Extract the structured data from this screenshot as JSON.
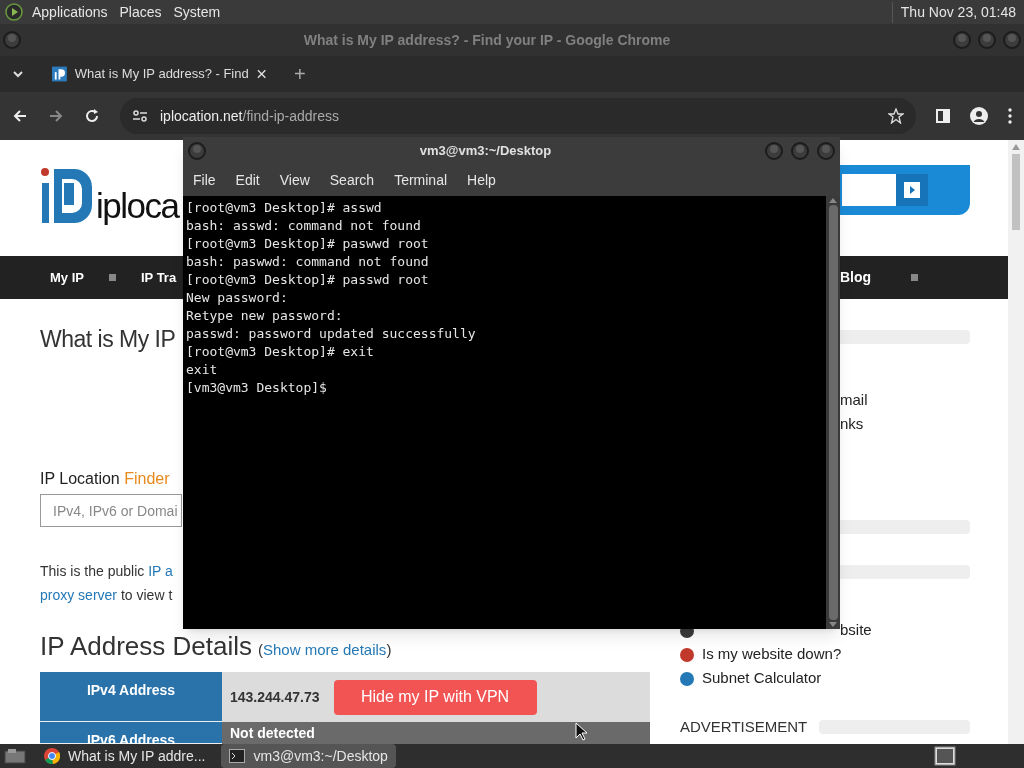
{
  "top_panel": {
    "menus": [
      "Applications",
      "Places",
      "System"
    ],
    "clock": "Thu Nov 23, 01:48"
  },
  "browser": {
    "title": "What is My IP address? - Find your IP - Google Chrome",
    "tabs": [
      {
        "title": "What is My IP address? - Find",
        "selected": true
      }
    ],
    "new_tab": "+",
    "url_host": "iplocation.net",
    "url_path": "/find-ip-address"
  },
  "page": {
    "logo_text": "iploca",
    "nav_left": [
      "My IP",
      "IP Tra"
    ],
    "nav_right": [
      "Blog"
    ],
    "heading": "What is My IP",
    "finder": {
      "label": "IP Location",
      "accent": "Finder"
    },
    "search_placeholder": "IPv4, IPv6 or Domai",
    "intro_lines": [
      [
        {
          "text": "This is the public ",
          "link": false
        },
        {
          "text": "IP a",
          "link": true
        }
      ],
      [
        {
          "text": "proxy server",
          "link": true
        },
        {
          "text": " to view t",
          "link": false
        }
      ]
    ],
    "details_heading": "IP Address Details",
    "details_note": {
      "open": "(",
      "link": "Show more details",
      "close": ")"
    },
    "details_rows": [
      {
        "label": "IPv4 Address",
        "value": "143.244.47.73",
        "action": "Hide my IP with VPN"
      },
      {
        "label": "IPv6 Address",
        "value": "Not detected"
      }
    ],
    "sidebar_fragments": [
      "mail",
      "nks"
    ],
    "tools": [
      {
        "label": "bsite",
        "color": "#3a3a3a"
      },
      {
        "label": "Is my website down?",
        "color": "#c0392b"
      },
      {
        "label": "Subnet Calculator",
        "color": "#2478b5"
      }
    ],
    "ad_label": "ADVERTISEMENT"
  },
  "terminal": {
    "title": "vm3@vm3:~/Desktop",
    "menus": [
      "File",
      "Edit",
      "View",
      "Search",
      "Terminal",
      "Help"
    ],
    "lines": [
      "[root@vm3 Desktop]# asswd",
      "bash: asswd: command not found",
      "[root@vm3 Desktop]# paswwd root",
      "bash: paswwd: command not found",
      "[root@vm3 Desktop]# passwd root",
      "New password:",
      "Retype new password:",
      "passwd: password updated successfully",
      "[root@vm3 Desktop]# exit",
      "exit",
      "[vm3@vm3 Desktop]$"
    ]
  },
  "taskbar": {
    "tasks": [
      {
        "title": "What is My IP addre...",
        "kind": "browser",
        "selected": false
      },
      {
        "title": "vm3@vm3:~/Desktop",
        "kind": "terminal",
        "selected": true
      }
    ]
  }
}
